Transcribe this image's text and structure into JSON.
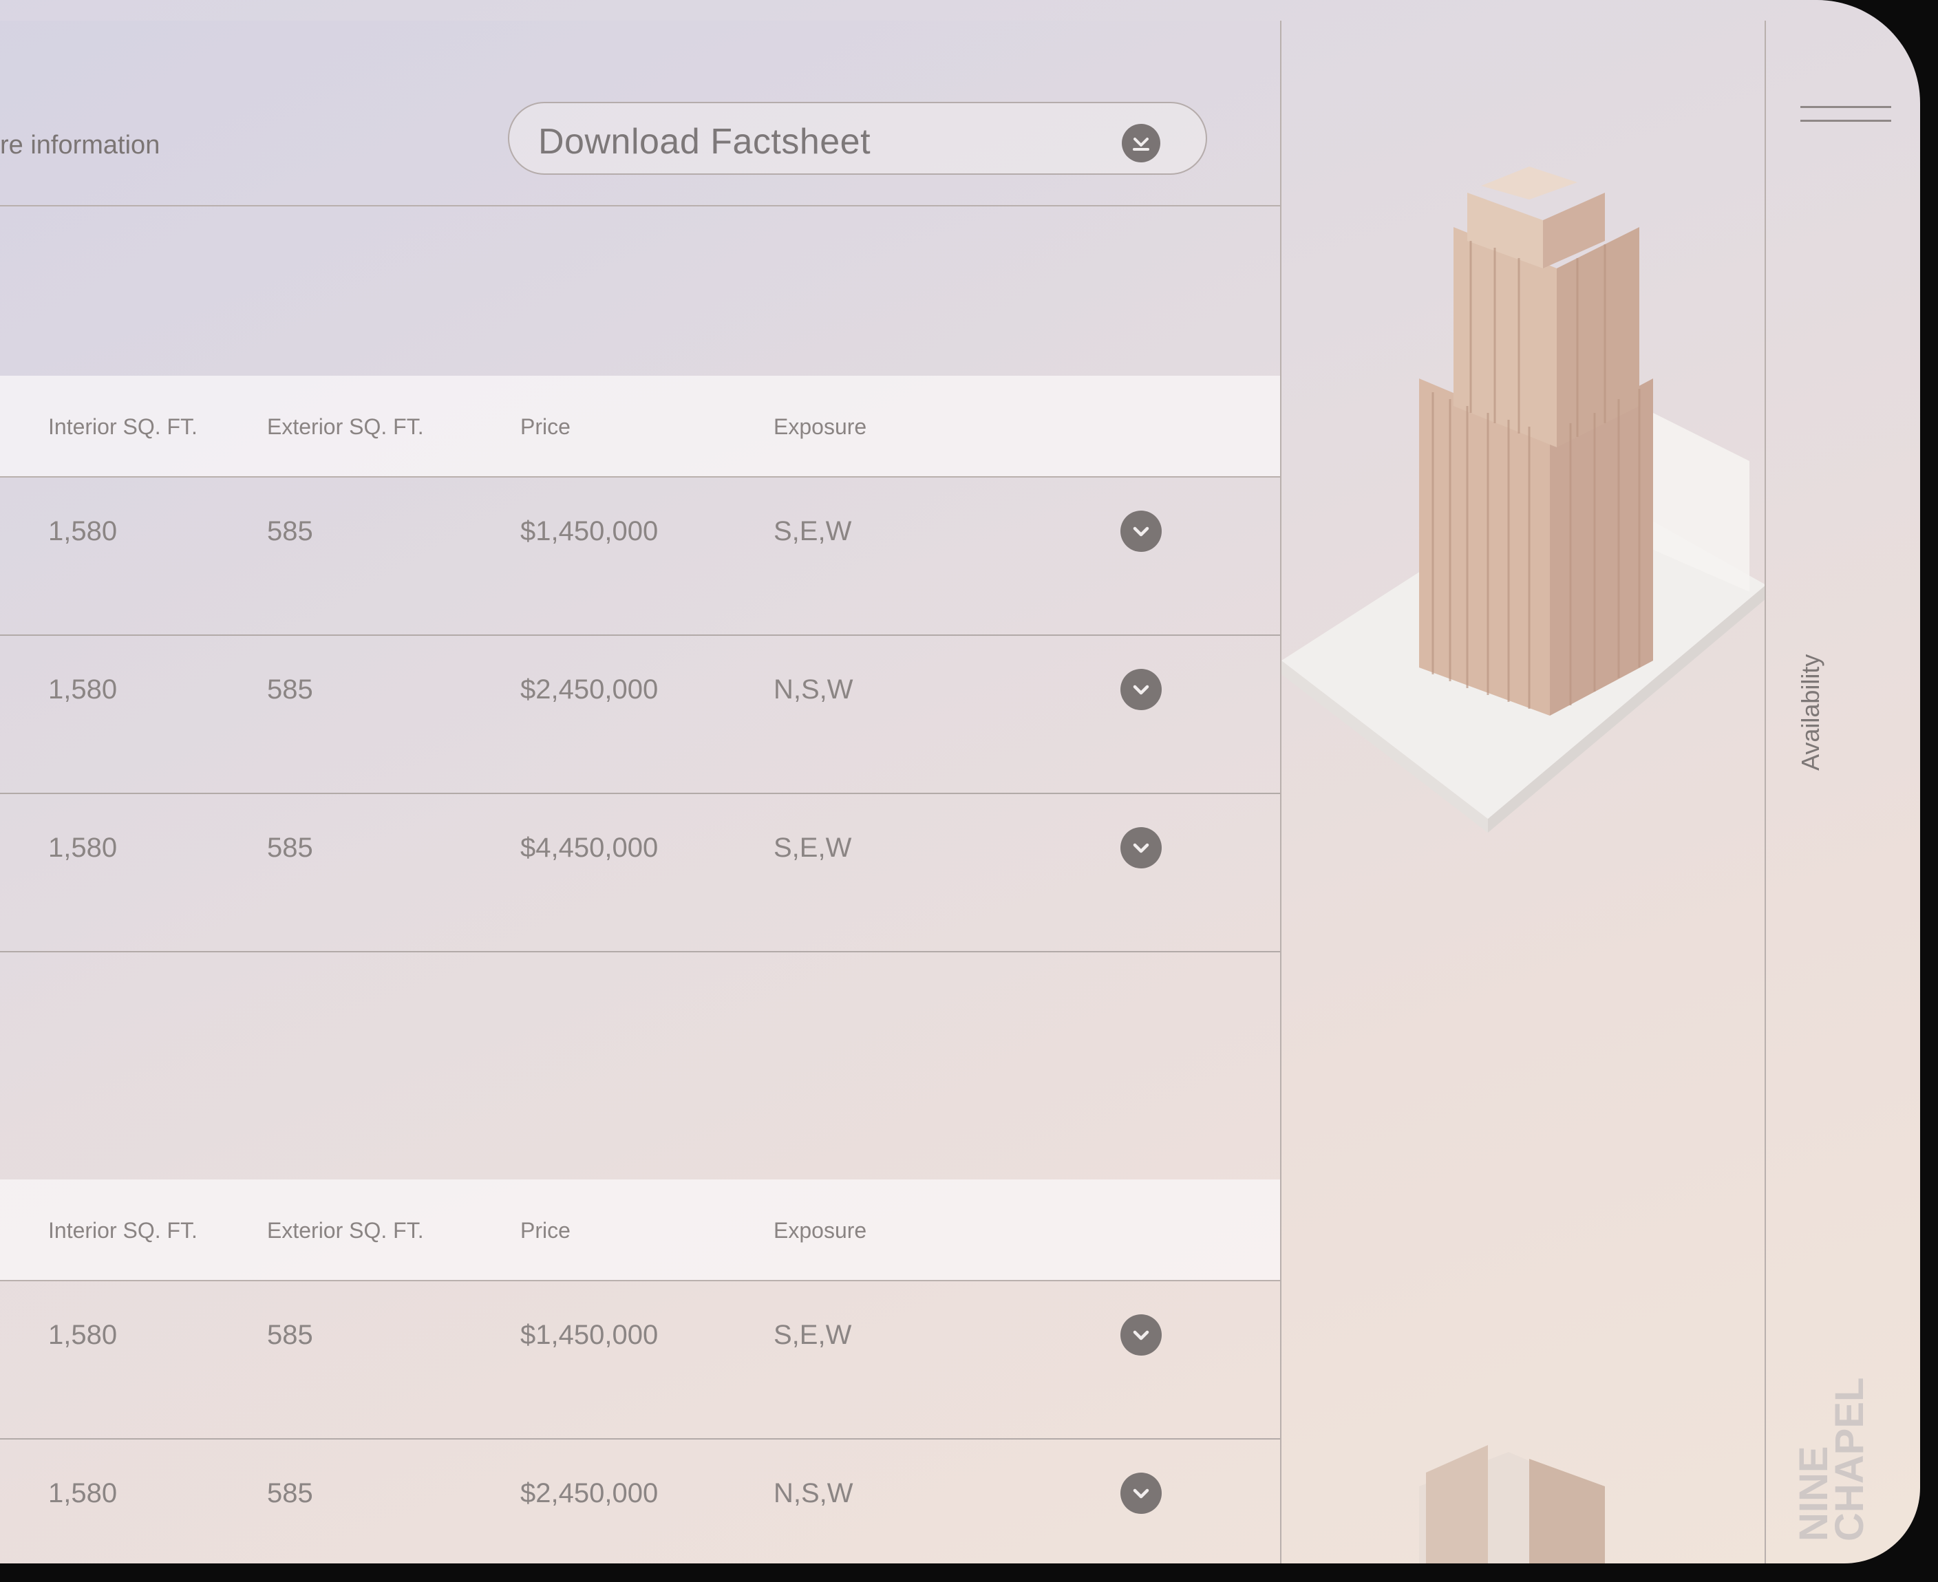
{
  "header": {
    "info_text": "re information",
    "download_label": "Download Factsheet",
    "download_icon": "download-circle-icon"
  },
  "tables": [
    {
      "headers": [
        "Interior SQ. FT.",
        "Exterior SQ. FT.",
        "Price",
        "Exposure"
      ],
      "rows": [
        {
          "interior": "1,580",
          "exterior": "585",
          "price": "$1,450,000",
          "exposure": "S,E,W"
        },
        {
          "interior": "1,580",
          "exterior": "585",
          "price": "$2,450,000",
          "exposure": "N,S,W"
        },
        {
          "interior": "1,580",
          "exterior": "585",
          "price": "$4,450,000",
          "exposure": "S,E,W"
        }
      ]
    },
    {
      "headers": [
        "Interior SQ. FT.",
        "Exterior SQ. FT.",
        "Price",
        "Exposure"
      ],
      "rows": [
        {
          "interior": "1,580",
          "exterior": "585",
          "price": "$1,450,000",
          "exposure": "S,E,W"
        },
        {
          "interior": "1,580",
          "exterior": "585",
          "price": "$2,450,000",
          "exposure": "N,S,W"
        }
      ]
    }
  ],
  "sidebar": {
    "menu_icon": "hamburger-icon",
    "availability_label": "Availability",
    "logo_line1": "NINE",
    "logo_line2": "CHAPEL"
  },
  "colors": {
    "text_primary": "#7b7574",
    "divider": "#b9b0ad",
    "building": "#d7b8a6"
  }
}
